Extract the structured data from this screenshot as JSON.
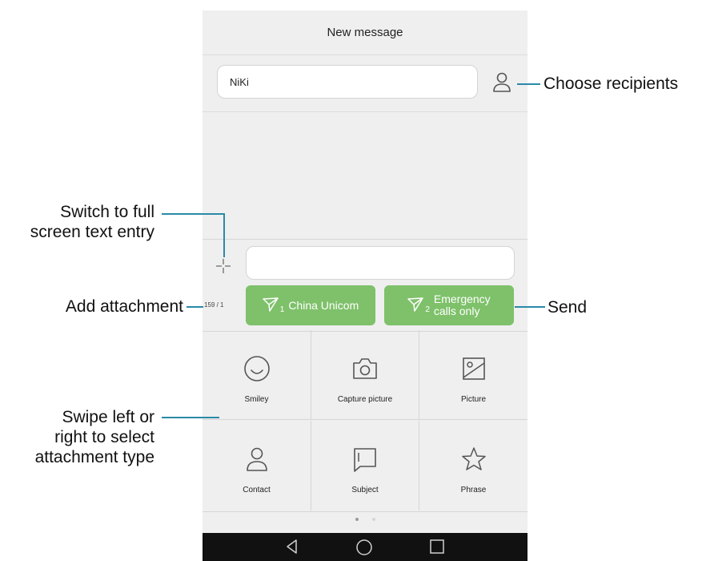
{
  "header": {
    "title": "New message"
  },
  "recipient": {
    "value": "NiKi",
    "icon": "person-icon"
  },
  "compose": {
    "char_count": "159 / 1",
    "message_value": "",
    "send_sim1": {
      "sim": "1",
      "label": "China Unicom",
      "icon": "send-icon"
    },
    "send_sim2": {
      "sim": "2",
      "line1": "Emergency",
      "line2": "calls only",
      "icon": "send-icon"
    }
  },
  "attachments": {
    "items": [
      {
        "label": "Smiley",
        "icon": "smiley-icon"
      },
      {
        "label": "Capture picture",
        "icon": "camera-icon"
      },
      {
        "label": "Picture",
        "icon": "picture-icon"
      },
      {
        "label": "Contact",
        "icon": "contact-icon"
      },
      {
        "label": "Subject",
        "icon": "subject-icon"
      },
      {
        "label": "Phrase",
        "icon": "star-icon"
      }
    ],
    "page_index": 1,
    "page_count": 2
  },
  "navbar": {
    "buttons": [
      "back-icon",
      "home-icon",
      "recents-icon"
    ]
  },
  "annotations": {
    "choose_recipients": "Choose recipients",
    "fullscreen_line1": "Switch to full",
    "fullscreen_line2": "screen text entry",
    "add_attachment": "Add attachment",
    "send": "Send",
    "swipe_line1": "Swipe left or",
    "swipe_line2": "right to select",
    "swipe_line3": "attachment type"
  },
  "colors": {
    "accent_green": "#7ec16a",
    "leader_line": "#2a8aa8",
    "phone_bg": "#efefef",
    "navbar_bg": "#111111"
  }
}
